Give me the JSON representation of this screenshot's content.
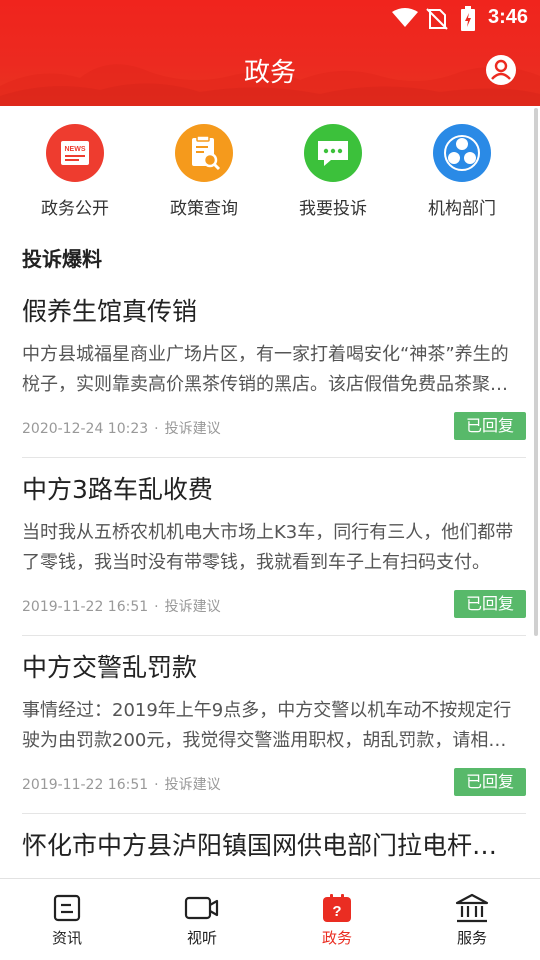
{
  "status_bar": {
    "time": "3:46",
    "icons": [
      "wifi-icon",
      "no-sim-icon",
      "battery-charging-icon"
    ]
  },
  "header": {
    "title": "政务",
    "profile_icon": "profile-icon"
  },
  "colors": {
    "brand": "#ec2a20",
    "badge": "#58b96a",
    "tab_active": "#ea2d22"
  },
  "quick_entries": [
    {
      "label": "政务公开",
      "icon": "news-icon",
      "color": "#ee3c2f"
    },
    {
      "label": "政策查询",
      "icon": "policy-search-icon",
      "color": "#f59a1c"
    },
    {
      "label": "我要投诉",
      "icon": "chat-icon",
      "color": "#3cc13b"
    },
    {
      "label": "机构部门",
      "icon": "org-icon",
      "color": "#2a8ae6"
    }
  ],
  "section_title": "投诉爆料",
  "feed": [
    {
      "title": "假养生馆真传销",
      "summary": "中方县城福星商业广场片区，有一家打着喝安化“神茶”养生的梲子，实则靠卖高价黑茶传销的黑店。该店假借免费品茶聚集中老年人，洗脑推销。",
      "date": "2020-12-24 10:23",
      "category": "投诉建议",
      "status": "已回复"
    },
    {
      "title": "中方3路车乱收费",
      "summary": "当时我从五桥农机机电大市场上K3车，同行有三人，他们都带了零钱，我当时没有带零钱，我就看到车子上有扫码支付。",
      "date": "2019-11-22 16:51",
      "category": "投诉建议",
      "status": "已回复"
    },
    {
      "title": "中方交警乱罚款",
      "summary": "事情经过：2019年上午9点多，中方交警以机车动不按规定行驶为由罚款200元，我觉得交警滥用职权，胡乱罚款，请相关部门调查处理。",
      "date": "2019-11-22 16:51",
      "category": "投诉建议",
      "status": "已回复"
    },
    {
      "title": "怀化市中方县泸阳镇国网供电部门拉电杆…"
    }
  ],
  "tabbar": [
    {
      "label": "资讯",
      "icon": "news-tab-icon"
    },
    {
      "label": "视听",
      "icon": "video-tab-icon"
    },
    {
      "label": "政务",
      "icon": "affairs-tab-icon",
      "active": true
    },
    {
      "label": "服务",
      "icon": "service-tab-icon"
    }
  ]
}
